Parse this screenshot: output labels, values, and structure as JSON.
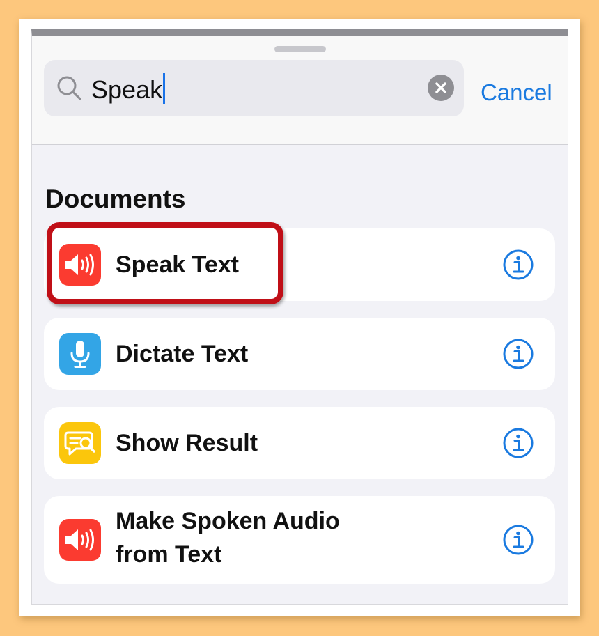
{
  "search": {
    "value": "Speak",
    "cancel_label": "Cancel"
  },
  "section": {
    "title": "Documents"
  },
  "actions": [
    {
      "label": "Speak Text",
      "icon": "speaker-icon",
      "color": "#fb3b30",
      "highlighted": true
    },
    {
      "label": "Dictate Text",
      "icon": "microphone-icon",
      "color": "#33a5e6",
      "highlighted": false
    },
    {
      "label": "Show Result",
      "icon": "show-result-icon",
      "color": "#fbc60c",
      "highlighted": false
    },
    {
      "label_line1": "Make Spoken Audio",
      "label_line2": "from Text",
      "icon": "speaker-icon",
      "color": "#fb3b30",
      "highlighted": false
    }
  ],
  "colors": {
    "accent": "#1a7ae0",
    "highlight_box": "#c00f17",
    "background": "#fdc77d"
  }
}
